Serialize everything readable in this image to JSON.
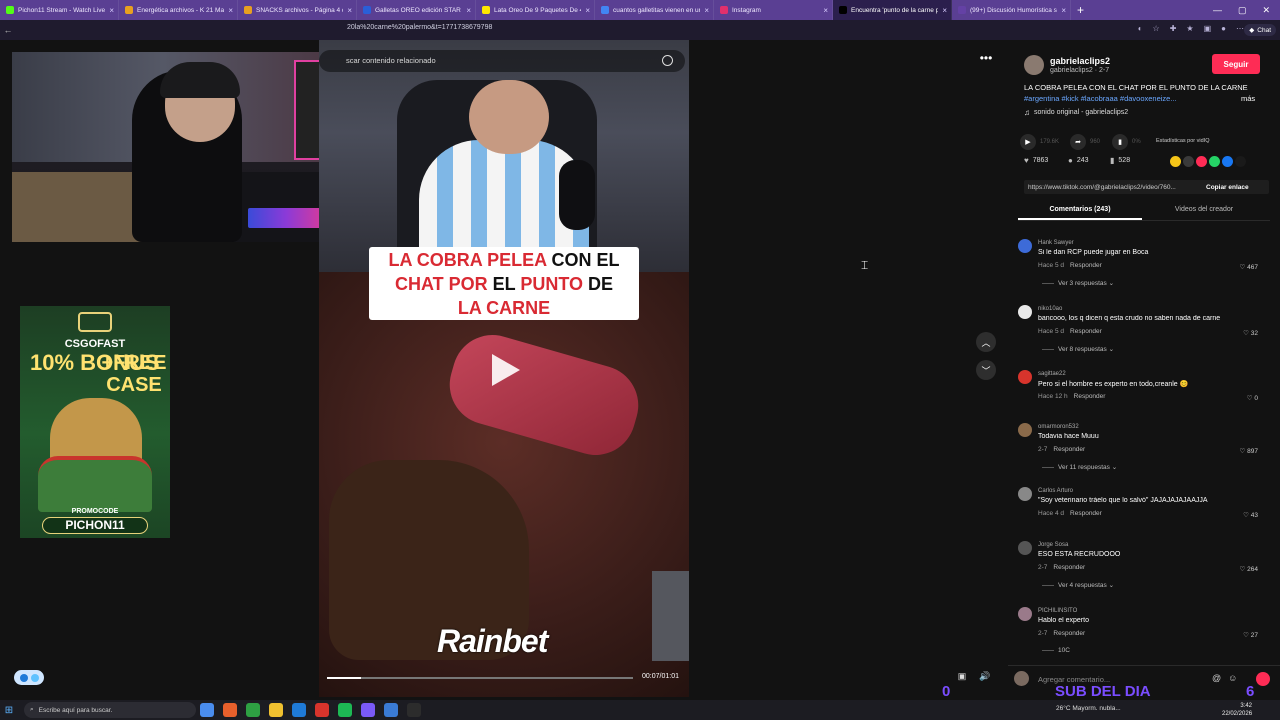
{
  "browser": {
    "tabs": [
      {
        "label": "Pichon11 Stream - Watch Live on",
        "color": "#53fc18",
        "active": false
      },
      {
        "label": "Energética archivos - K 21 Market",
        "color": "#e8a020",
        "active": false
      },
      {
        "label": "SNACKS archivos - Página 4 de 5",
        "color": "#e8a020",
        "active": false
      },
      {
        "label": "Galletas OREO edición STAR WAR",
        "color": "#2a5fd8",
        "active": false
      },
      {
        "label": "Lata Oreo De 9 Paquetes De 4 Un",
        "color": "#ffe600",
        "active": false
      },
      {
        "label": "cuantos galletitas vienen en un pa",
        "color": "#4285f4",
        "active": false
      },
      {
        "label": "Instagram",
        "color": "#e1306c",
        "active": false
      },
      {
        "label": "Encuentra 'punto de la carne pale",
        "color": "#000000",
        "active": true
      },
      {
        "label": "(99+) Discusión Humorística sobre",
        "color": "#6441a5",
        "active": false
      }
    ],
    "new_tab": "+",
    "window_controls": [
      "—",
      "▢",
      "✕"
    ],
    "url": "20la%20carne%20palermo&t=1771738679798",
    "chat_button": "Chat"
  },
  "video": {
    "search_placeholder": "scar contenido relacionado",
    "caption": {
      "line1_red": "LA COBRA PELEA ",
      "line1_black": "CON EL",
      "line2_red_a": "CHAT POR ",
      "line2_black": "EL ",
      "line2_red_b": "PUNTO ",
      "line2_black_b": "DE",
      "line3_red": "LA CARNE"
    },
    "watermark": "Rainbet",
    "timestamp": "00:07/01:01",
    "progress": 0.11
  },
  "ad": {
    "brand": "CSGOFAST",
    "bonus": "10% BONUS",
    "free_case": "+FREE CASE",
    "promocode_label": "PROMOCODE",
    "promocode": "PICHON11"
  },
  "post": {
    "username": "gabrielaclips2",
    "handle": "gabrielaclips2 · 2-7",
    "follow_label": "Seguir",
    "description": "LA COBRA PELEA CON EL CHAT POR EL PUNTO DE LA CARNE",
    "hashtags": "#argentina #kick #lacobraaa #davooxeneize...",
    "more_label": "más",
    "sound": "sonido original - gabrielaclips2",
    "stats": {
      "plays": "179.6K",
      "shares": "960",
      "likes_pct": "0%",
      "estadisticas": "Estadísticas por vidIQ"
    },
    "actions": {
      "likes": "7863",
      "comments": "243",
      "saves": "528"
    },
    "link": "https://www.tiktok.com/@gabrielaclips2/video/760...",
    "copy_link": "Copiar enlace",
    "tab_comments": "Comentarios (243)",
    "tab_videos": "Videos del creador"
  },
  "comments": [
    {
      "user": "Hank Sawyer",
      "text": "Si le dan RCP puede jugar en Boca",
      "when": "Hace 5 d",
      "reply": "Responder",
      "likes": "467",
      "more": "Ver 3 respuestas ⌄",
      "color": "#3d6bd8"
    },
    {
      "user": "niko10ao",
      "text": "bancooo, los q dicen q esta crudo no saben nada de carne",
      "when": "Hace 5 d",
      "reply": "Responder",
      "likes": "32",
      "more": "Ver 8 respuestas ⌄",
      "color": "#e8e8e8"
    },
    {
      "user": "sagittae22",
      "text": "Pero si el hombre es experto en todo,creanle 😊",
      "when": "Hace 12 h",
      "reply": "Responder",
      "likes": "0",
      "more": "",
      "color": "#d8342c"
    },
    {
      "user": "omarmoron532",
      "text": "Todavia hace Muuu",
      "when": "2-7",
      "reply": "Responder",
      "likes": "897",
      "more": "Ver 11 respuestas ⌄",
      "color": "#8a6a4a"
    },
    {
      "user": "Carlos Arturo",
      "text": "\"Soy veterinario tráelo que lo salvó\" JAJAJAJAJAAJJA",
      "when": "Hace 4 d",
      "reply": "Responder",
      "likes": "43",
      "more": "",
      "color": "#888888"
    },
    {
      "user": "Jorge Sosa",
      "text": "ESO ESTA RECRUDOOO",
      "when": "2-7",
      "reply": "Responder",
      "likes": "264",
      "more": "Ver 4 respuestas ⌄",
      "color": "#555555"
    },
    {
      "user": "PICHILINSITO",
      "text": "Hablo el experto",
      "when": "2-7",
      "reply": "Responder",
      "likes": "27",
      "more": "10C",
      "color": "#9a7a8a"
    }
  ],
  "comment_input_placeholder": "Agregar comentario...",
  "overlay": {
    "left_count": "0",
    "title": "SUB DEL DIA",
    "right_count": "6"
  },
  "taskbar": {
    "search_placeholder": "Escribe aquí para buscar.",
    "weather": "26°C  Mayorm. nubla...",
    "time": "3:42",
    "date": "22/02/2026",
    "apps": [
      "#4a8df0",
      "#e8602c",
      "#2ea043",
      "#f0c030",
      "#1f7ad8",
      "#d8342c",
      "#1db954",
      "#7a5af8",
      "#3a7bd5",
      "#2c2c2c"
    ]
  }
}
